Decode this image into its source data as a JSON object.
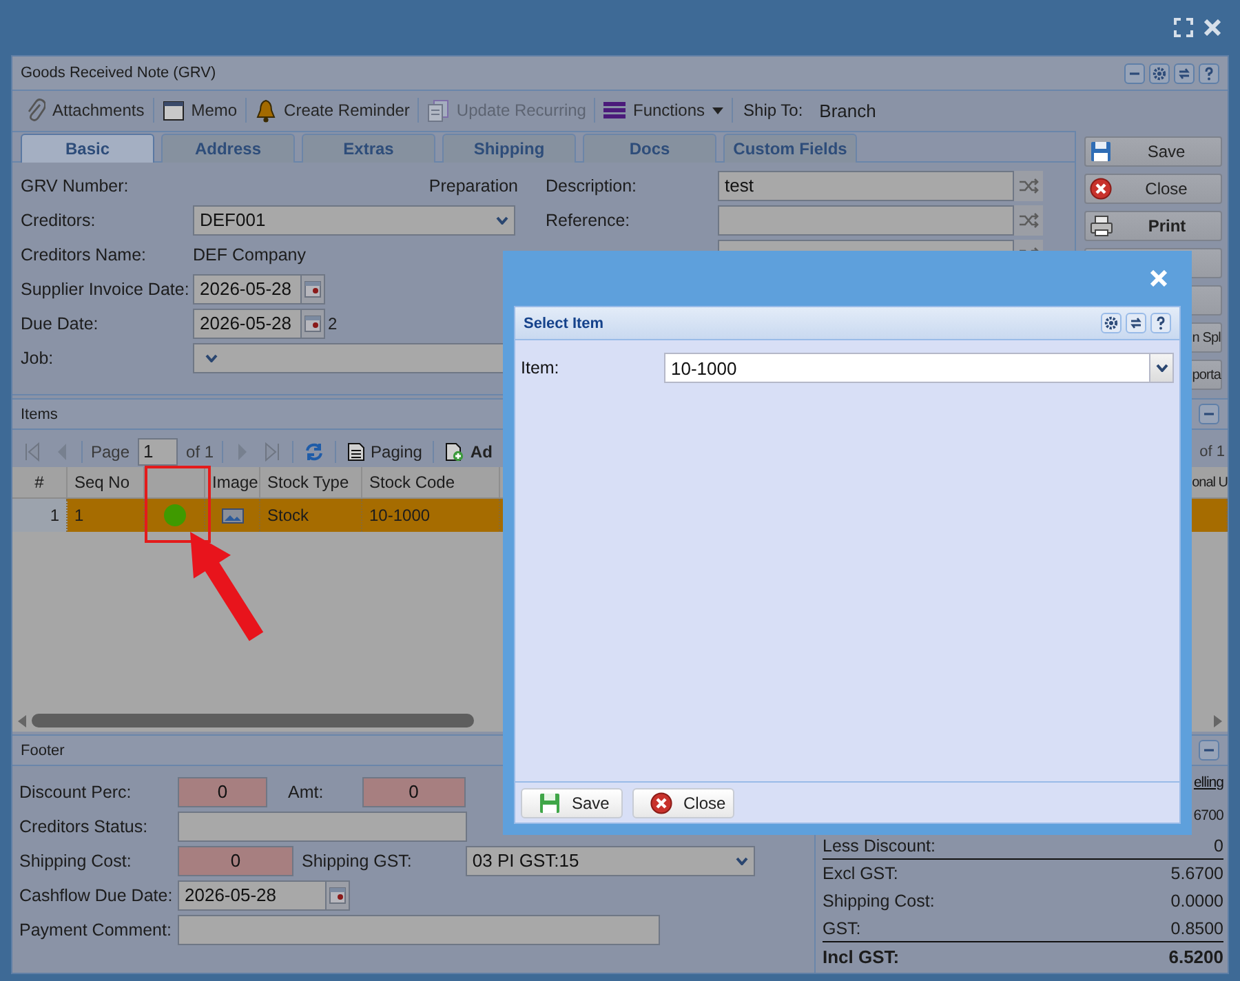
{
  "window": {
    "title": "Goods Received Note (GRV)"
  },
  "toolbar": [
    {
      "label": "Attachments",
      "kind": "attach",
      "disabled": false
    },
    {
      "label": "Memo",
      "kind": "memo",
      "disabled": false
    },
    {
      "label": "Create Reminder",
      "kind": "bell",
      "disabled": false
    },
    {
      "label": "Update Recurring",
      "kind": "recurring",
      "disabled": true
    },
    {
      "label": "Functions",
      "kind": "menu",
      "disabled": false
    }
  ],
  "ship_to": {
    "label": "Ship To:",
    "value": "Branch"
  },
  "tabs": [
    {
      "label": "Basic",
      "selected": true
    },
    {
      "label": "Address",
      "selected": false
    },
    {
      "label": "Extras",
      "selected": false
    },
    {
      "label": "Shipping",
      "selected": false
    },
    {
      "label": "Docs",
      "selected": false
    },
    {
      "label": "Custom Fields",
      "selected": false
    }
  ],
  "form_left": [
    {
      "label": "GRV Number:",
      "kind": "status",
      "value": "Preparation"
    },
    {
      "label": "Creditors:",
      "kind": "combo",
      "value": "DEF001"
    },
    {
      "label": "Creditors Name:",
      "kind": "text",
      "value": "DEF Company"
    },
    {
      "label": "Supplier Invoice Date:",
      "kind": "date",
      "value": "2026-05-28"
    },
    {
      "label": "Due Date:",
      "kind": "date",
      "value": "2026-05-28",
      "suffix": "2"
    },
    {
      "label": "Job:",
      "kind": "combo"
    }
  ],
  "form_right": [
    {
      "label": "Description:",
      "kind": "field",
      "value": "test"
    },
    {
      "label": "Reference:",
      "kind": "field"
    },
    {
      "kind": "field"
    }
  ],
  "side_buttons": [
    {
      "label": "Save",
      "kind": "save"
    },
    {
      "label": "Close",
      "kind": "close"
    },
    {
      "label": "Print",
      "kind": "print"
    },
    {
      "kind": "plain"
    },
    {
      "kind": "plain"
    },
    {
      "label": "n Spl",
      "kind": "plain"
    },
    {
      "label": "porta",
      "kind": "plain"
    }
  ],
  "items": {
    "title": "Items",
    "pager": {
      "page_label": "Page",
      "page": "1",
      "page_count": "of 1",
      "paging": "Paging",
      "add": "Ad",
      "page_count_right": "of 1"
    },
    "columns": [
      {
        "label": "#",
        "kind": "number"
      },
      {
        "label": "Seq No",
        "kind": "text"
      },
      {
        "kind": "status"
      },
      {
        "label": "Image",
        "kind": "text"
      },
      {
        "label": "Stock Type",
        "kind": "text"
      },
      {
        "label": "Stock Code",
        "kind": "text"
      },
      {
        "label": "onal U",
        "kind": "text"
      }
    ],
    "rows": [
      {
        "number": "1",
        "seq_no": "1",
        "color": "#3f9a00",
        "has_image": true,
        "stock_type": "Stock",
        "stock_code": "10-1000",
        "selected": true
      }
    ]
  },
  "footer": {
    "title": "Footer",
    "discount_perc": {
      "label": "Discount Perc:",
      "kind": "number",
      "value": "0"
    },
    "amt": {
      "label": "Amt:",
      "kind": "number",
      "value": "0"
    },
    "creditors_status": {
      "label": "Creditors Status:"
    },
    "shipping_cost": {
      "label": "Shipping Cost:",
      "kind": "number",
      "value": "0"
    },
    "shipping_gst": {
      "label": "Shipping GST:",
      "value": "03 PI GST:15"
    },
    "cashflow_due_date": {
      "label": "Cashflow Due Date:",
      "value": "2026-05-28"
    },
    "payment_comment": {
      "label": "Payment Comment:"
    }
  },
  "summary": {
    "link": "elling",
    "first_value": "6700",
    "rows": [
      {
        "label": "Less Discount:",
        "value": "0",
        "kind": "line",
        "rule": true
      },
      {
        "label": "Excl GST:",
        "value": "5.6700",
        "kind": "line",
        "rule": false
      },
      {
        "label": "Shipping Cost:",
        "value": "0.0000",
        "kind": "line",
        "rule": false
      },
      {
        "label": "GST:",
        "value": "0.8500",
        "kind": "line",
        "rule": true
      },
      {
        "label": "Incl GST:",
        "value": "6.5200",
        "kind": "total",
        "rule": false
      }
    ]
  },
  "dialog": {
    "panel_title": "Select Item",
    "item_label": "Item:",
    "item_value": "10-1000",
    "buttons": [
      {
        "label": "Save",
        "kind": "save"
      },
      {
        "label": "Close",
        "kind": "close"
      }
    ]
  }
}
